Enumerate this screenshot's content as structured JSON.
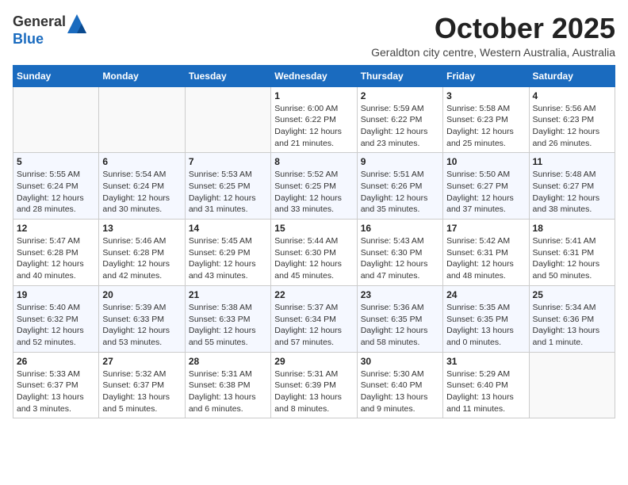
{
  "header": {
    "logo_line1": "General",
    "logo_line2": "Blue",
    "month": "October 2025",
    "location": "Geraldton city centre, Western Australia, Australia"
  },
  "weekdays": [
    "Sunday",
    "Monday",
    "Tuesday",
    "Wednesday",
    "Thursday",
    "Friday",
    "Saturday"
  ],
  "weeks": [
    [
      {
        "day": "",
        "info": ""
      },
      {
        "day": "",
        "info": ""
      },
      {
        "day": "",
        "info": ""
      },
      {
        "day": "1",
        "info": "Sunrise: 6:00 AM\nSunset: 6:22 PM\nDaylight: 12 hours\nand 21 minutes."
      },
      {
        "day": "2",
        "info": "Sunrise: 5:59 AM\nSunset: 6:22 PM\nDaylight: 12 hours\nand 23 minutes."
      },
      {
        "day": "3",
        "info": "Sunrise: 5:58 AM\nSunset: 6:23 PM\nDaylight: 12 hours\nand 25 minutes."
      },
      {
        "day": "4",
        "info": "Sunrise: 5:56 AM\nSunset: 6:23 PM\nDaylight: 12 hours\nand 26 minutes."
      }
    ],
    [
      {
        "day": "5",
        "info": "Sunrise: 5:55 AM\nSunset: 6:24 PM\nDaylight: 12 hours\nand 28 minutes."
      },
      {
        "day": "6",
        "info": "Sunrise: 5:54 AM\nSunset: 6:24 PM\nDaylight: 12 hours\nand 30 minutes."
      },
      {
        "day": "7",
        "info": "Sunrise: 5:53 AM\nSunset: 6:25 PM\nDaylight: 12 hours\nand 31 minutes."
      },
      {
        "day": "8",
        "info": "Sunrise: 5:52 AM\nSunset: 6:25 PM\nDaylight: 12 hours\nand 33 minutes."
      },
      {
        "day": "9",
        "info": "Sunrise: 5:51 AM\nSunset: 6:26 PM\nDaylight: 12 hours\nand 35 minutes."
      },
      {
        "day": "10",
        "info": "Sunrise: 5:50 AM\nSunset: 6:27 PM\nDaylight: 12 hours\nand 37 minutes."
      },
      {
        "day": "11",
        "info": "Sunrise: 5:48 AM\nSunset: 6:27 PM\nDaylight: 12 hours\nand 38 minutes."
      }
    ],
    [
      {
        "day": "12",
        "info": "Sunrise: 5:47 AM\nSunset: 6:28 PM\nDaylight: 12 hours\nand 40 minutes."
      },
      {
        "day": "13",
        "info": "Sunrise: 5:46 AM\nSunset: 6:28 PM\nDaylight: 12 hours\nand 42 minutes."
      },
      {
        "day": "14",
        "info": "Sunrise: 5:45 AM\nSunset: 6:29 PM\nDaylight: 12 hours\nand 43 minutes."
      },
      {
        "day": "15",
        "info": "Sunrise: 5:44 AM\nSunset: 6:30 PM\nDaylight: 12 hours\nand 45 minutes."
      },
      {
        "day": "16",
        "info": "Sunrise: 5:43 AM\nSunset: 6:30 PM\nDaylight: 12 hours\nand 47 minutes."
      },
      {
        "day": "17",
        "info": "Sunrise: 5:42 AM\nSunset: 6:31 PM\nDaylight: 12 hours\nand 48 minutes."
      },
      {
        "day": "18",
        "info": "Sunrise: 5:41 AM\nSunset: 6:31 PM\nDaylight: 12 hours\nand 50 minutes."
      }
    ],
    [
      {
        "day": "19",
        "info": "Sunrise: 5:40 AM\nSunset: 6:32 PM\nDaylight: 12 hours\nand 52 minutes."
      },
      {
        "day": "20",
        "info": "Sunrise: 5:39 AM\nSunset: 6:33 PM\nDaylight: 12 hours\nand 53 minutes."
      },
      {
        "day": "21",
        "info": "Sunrise: 5:38 AM\nSunset: 6:33 PM\nDaylight: 12 hours\nand 55 minutes."
      },
      {
        "day": "22",
        "info": "Sunrise: 5:37 AM\nSunset: 6:34 PM\nDaylight: 12 hours\nand 57 minutes."
      },
      {
        "day": "23",
        "info": "Sunrise: 5:36 AM\nSunset: 6:35 PM\nDaylight: 12 hours\nand 58 minutes."
      },
      {
        "day": "24",
        "info": "Sunrise: 5:35 AM\nSunset: 6:35 PM\nDaylight: 13 hours\nand 0 minutes."
      },
      {
        "day": "25",
        "info": "Sunrise: 5:34 AM\nSunset: 6:36 PM\nDaylight: 13 hours\nand 1 minute."
      }
    ],
    [
      {
        "day": "26",
        "info": "Sunrise: 5:33 AM\nSunset: 6:37 PM\nDaylight: 13 hours\nand 3 minutes."
      },
      {
        "day": "27",
        "info": "Sunrise: 5:32 AM\nSunset: 6:37 PM\nDaylight: 13 hours\nand 5 minutes."
      },
      {
        "day": "28",
        "info": "Sunrise: 5:31 AM\nSunset: 6:38 PM\nDaylight: 13 hours\nand 6 minutes."
      },
      {
        "day": "29",
        "info": "Sunrise: 5:31 AM\nSunset: 6:39 PM\nDaylight: 13 hours\nand 8 minutes."
      },
      {
        "day": "30",
        "info": "Sunrise: 5:30 AM\nSunset: 6:40 PM\nDaylight: 13 hours\nand 9 minutes."
      },
      {
        "day": "31",
        "info": "Sunrise: 5:29 AM\nSunset: 6:40 PM\nDaylight: 13 hours\nand 11 minutes."
      },
      {
        "day": "",
        "info": ""
      }
    ]
  ]
}
